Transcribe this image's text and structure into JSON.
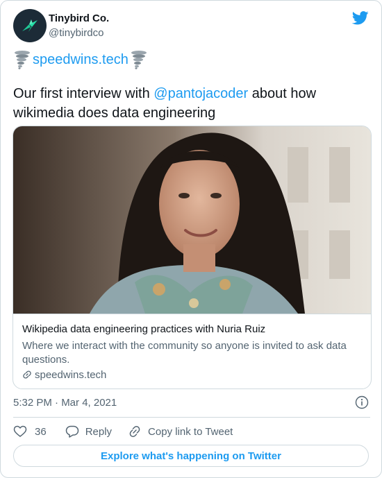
{
  "author": {
    "name": "Tinybird Co.",
    "handle": "@tinybirdco"
  },
  "tweet": {
    "link_label": "speedwins.tech",
    "text_before": "Our first interview with ",
    "mention": "@pantojacoder",
    "text_after": " about how wikimedia does data engineering"
  },
  "link_card": {
    "title": "Wikipedia data engineering practices with Nuria Ruiz",
    "description": "Where we interact with the community so anyone is invited to ask data questions.",
    "domain": "speedwins.tech"
  },
  "meta": {
    "timestamp": "5:32 PM · Mar 4, 2021"
  },
  "actions": {
    "like_count": "36",
    "reply_label": "Reply",
    "copy_label": "Copy link to Tweet"
  },
  "footer": {
    "explore_label": "Explore what's happening on Twitter"
  },
  "colors": {
    "accent": "#1d9bf0",
    "text_primary": "#0f1419",
    "text_secondary": "#536471",
    "border": "#cfd9de"
  },
  "icons": {
    "twitter": "twitter-bird-icon",
    "tornado": "tornado-emoji-icon",
    "info": "info-icon",
    "like": "heart-icon",
    "reply": "reply-bubble-icon",
    "copy": "link-chain-icon"
  }
}
